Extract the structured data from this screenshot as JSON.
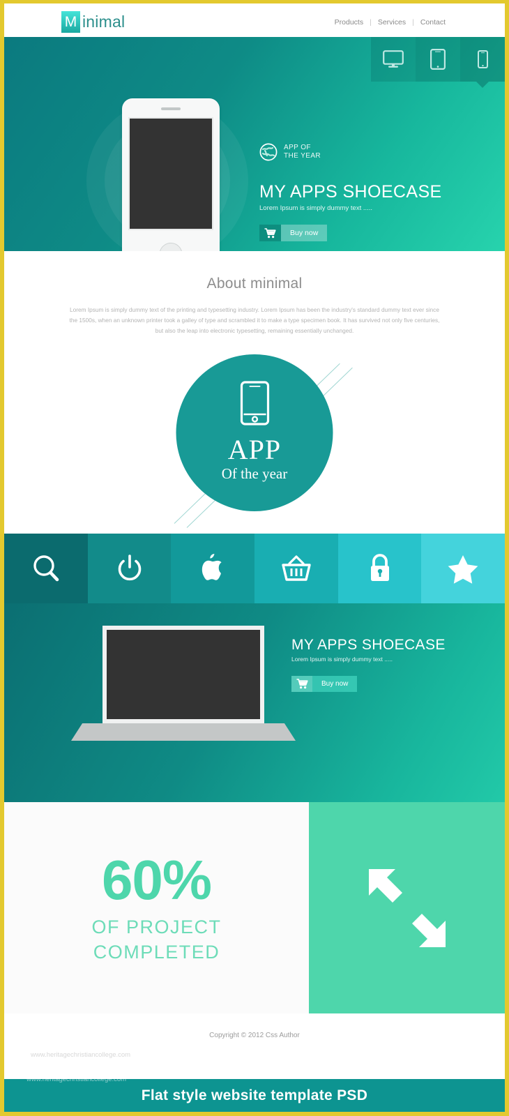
{
  "theme": {
    "border_color": "#e3c92f",
    "teal_dark": "#0b6b6e",
    "teal": "#189a96",
    "mint": "#4ed6ab",
    "caption_bg": "#0d9491"
  },
  "header": {
    "logo_initial": "M",
    "logo_rest": "inimal",
    "nav": [
      {
        "label": "Products"
      },
      {
        "label": "Services"
      },
      {
        "label": "Contact"
      }
    ],
    "separator": "|"
  },
  "hero": {
    "device_tabs": [
      {
        "name": "desktop",
        "active": false
      },
      {
        "name": "tablet",
        "active": false
      },
      {
        "name": "mobile",
        "active": true
      }
    ],
    "award_line1": "APP OF",
    "award_line2": "THE YEAR",
    "title": "MY APPS SHOECASE",
    "subtitle": "Lorem Ipsum is simply dummy text .....",
    "buy_label": "Buy now"
  },
  "about": {
    "heading": "About minimal",
    "paragraph": "Lorem Ipsum is simply dummy text of the printing and typesetting industry. Lorem Ipsum has been the industry's standard dummy text ever since the 1500s, when an unknown printer took a galley of type and scrambled it to make a type specimen book. It has survived not only five centuries, but also the leap into electronic typesetting, remaining essentially unchanged.",
    "badge_title": "APP",
    "badge_subtitle": "Of the year"
  },
  "icon_bar": {
    "tiles": [
      {
        "icon": "search-icon",
        "color": "#0b6b6e"
      },
      {
        "icon": "power-icon",
        "color": "#128b8a"
      },
      {
        "icon": "apple-icon",
        "color": "#12999a"
      },
      {
        "icon": "basket-icon",
        "color": "#19aeb2"
      },
      {
        "icon": "lock-icon",
        "color": "#28c3cb"
      },
      {
        "icon": "star-icon",
        "color": "#44d3dc"
      }
    ]
  },
  "hero2": {
    "title": "MY APPS SHOECASE",
    "subtitle": "Lorem Ipsum is simply dummy text .....",
    "buy_label": "Buy now"
  },
  "stats": {
    "percent": "60%",
    "line1": "OF PROJECT",
    "line2": "COMPLETED",
    "icon": "resize-diagonal-icon"
  },
  "footer": {
    "copyright": "Copyright © 2012 Css Author",
    "watermark": "www.heritagechristiancollege.com",
    "caption": "Flat style  website template PSD"
  }
}
